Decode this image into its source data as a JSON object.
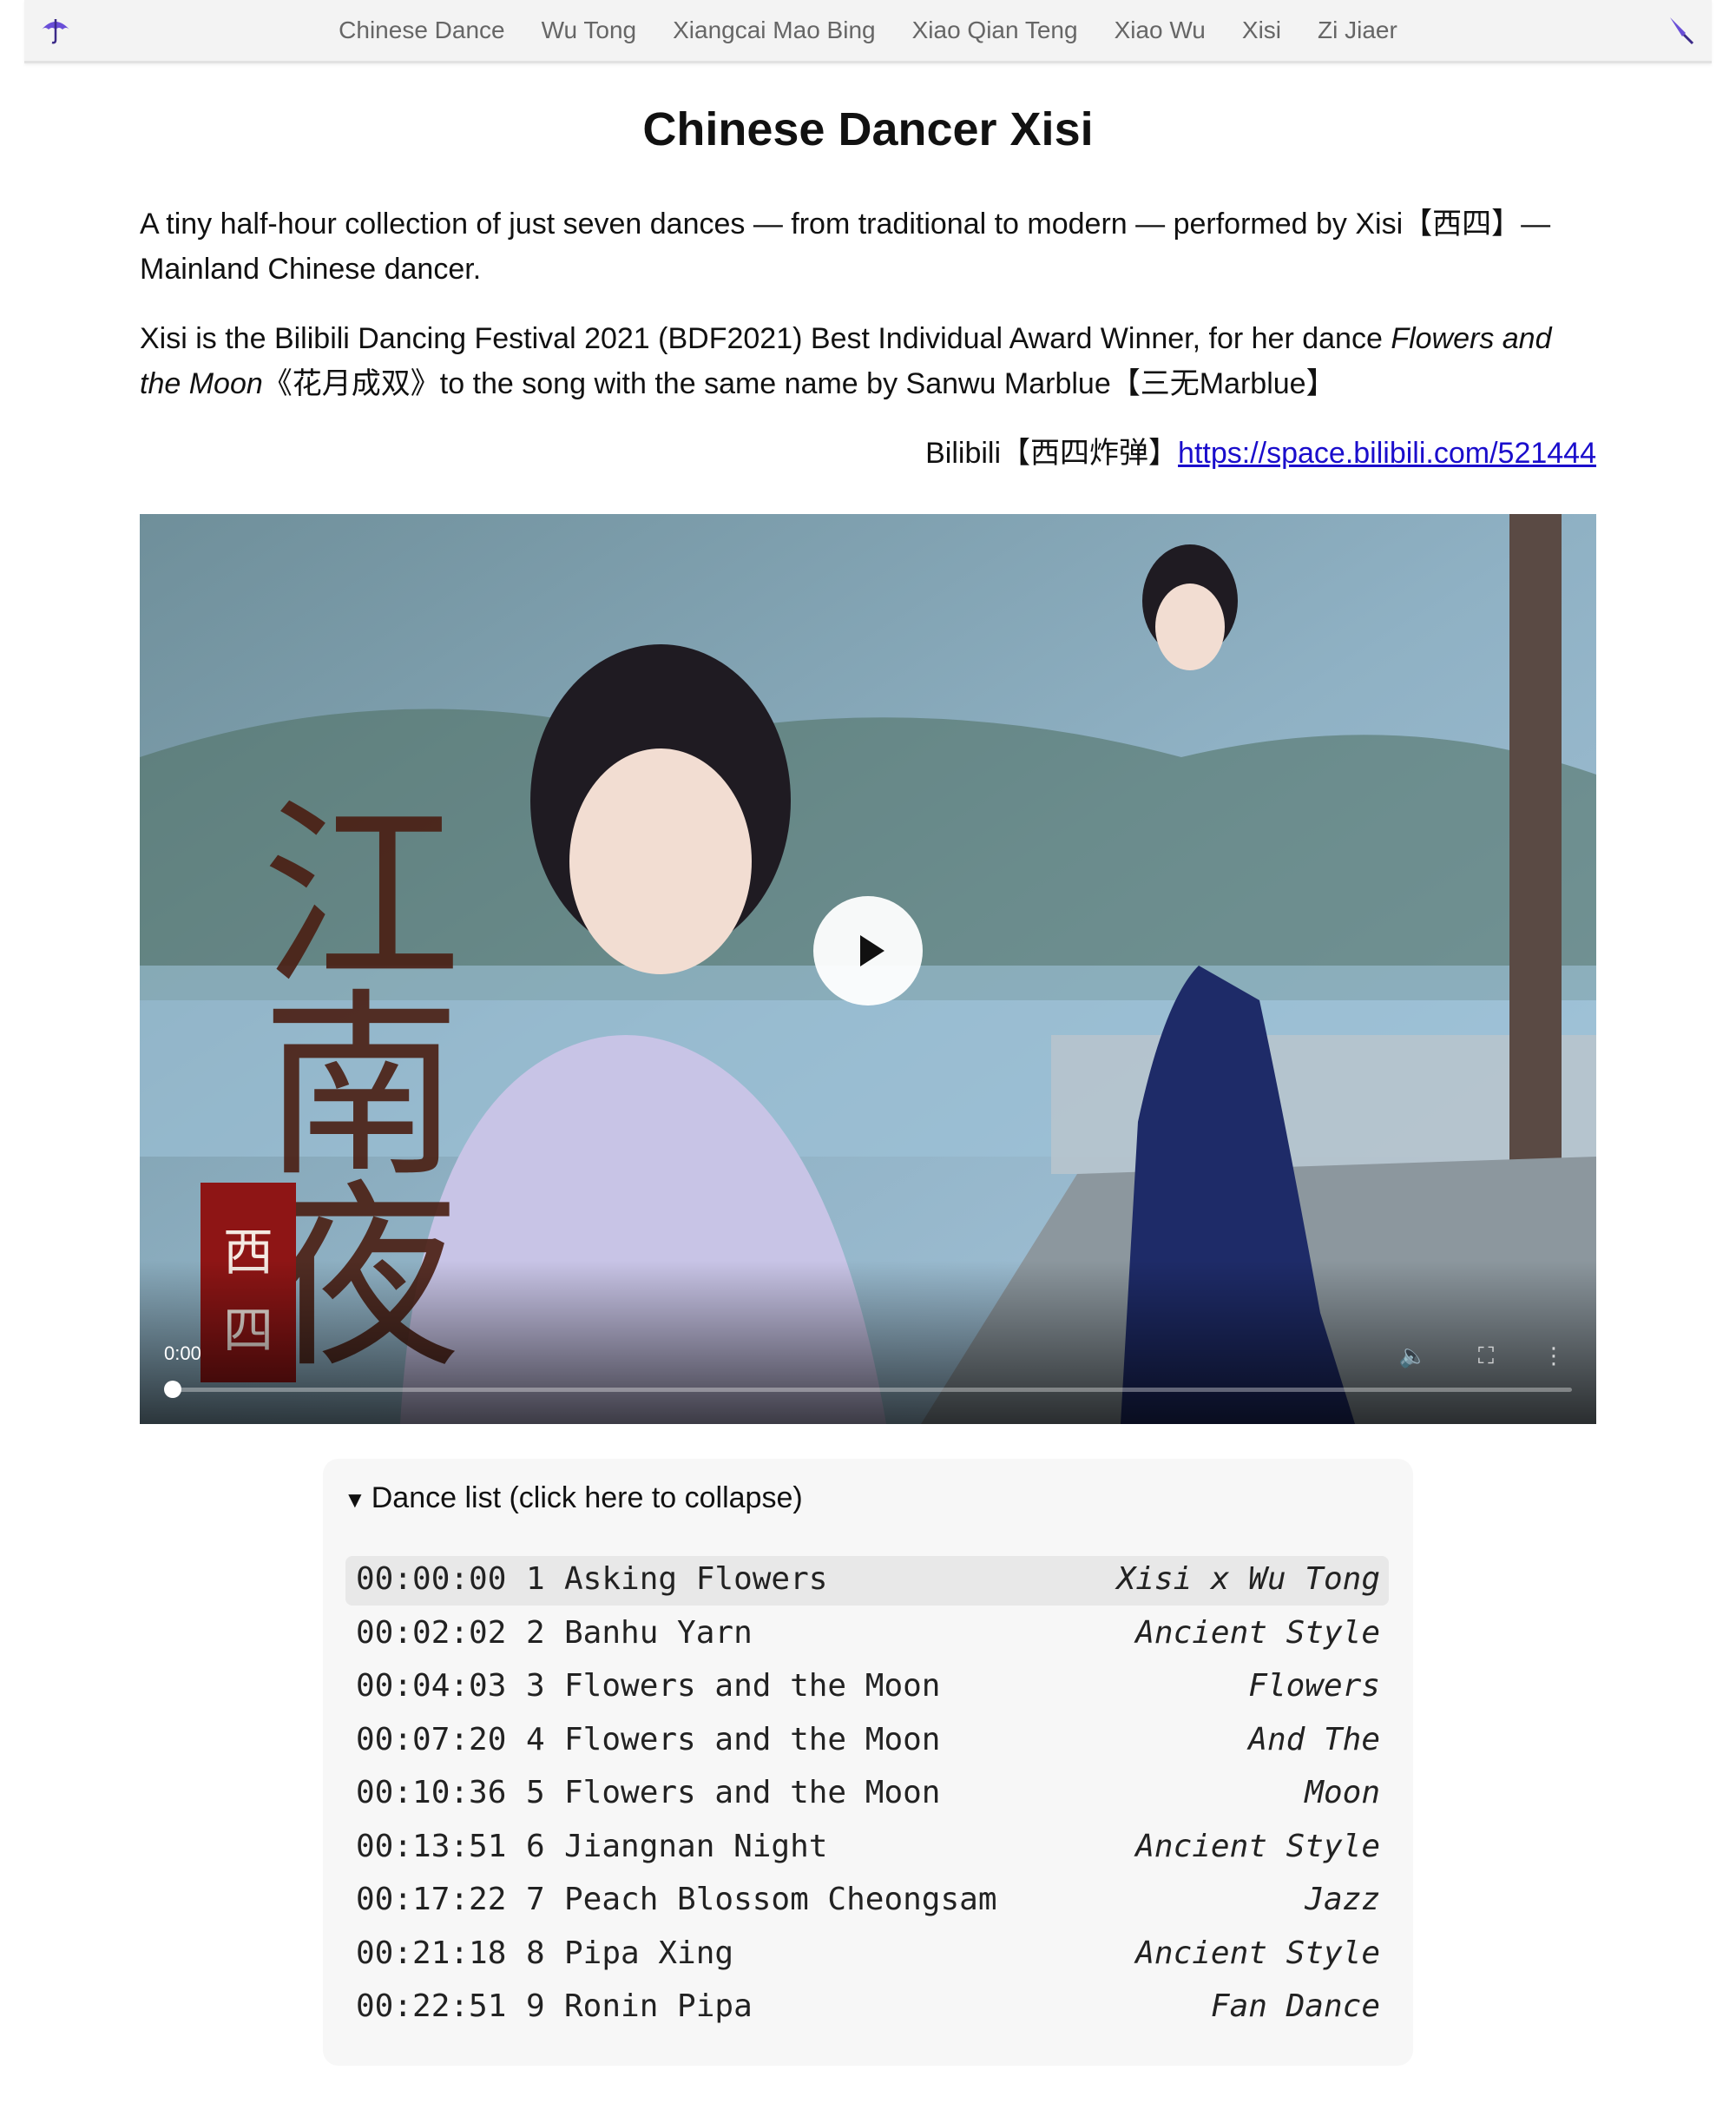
{
  "nav": {
    "left_icon": "umbrella-open-icon",
    "right_icon": "umbrella-closed-icon",
    "links": [
      "Chinese Dance",
      "Wu Tong",
      "Xiangcai Mao Bing",
      "Xiao Qian Teng",
      "Xiao Wu",
      "Xisi",
      "Zi Jiaer"
    ]
  },
  "page": {
    "title": "Chinese Dancer Xisi",
    "intro": "A tiny half-hour collection of just seven dances — from traditional to modern — performed by Xisi【西四】— Mainland Chinese dancer.",
    "award_text_1": "Xisi is the Bilibili Dancing Festival 2021 (BDF2021) Best Individual Award Winner, for her dance ",
    "award_italic": "Flowers and the Moon",
    "award_text_2": "《花月成双》to the song with the same name by Sanwu Marblue【三无Marblue】",
    "bili_label": "Bilibili【西四炸弹】",
    "bili_link": "https://space.bilibili.com/521444"
  },
  "video": {
    "time": "0:00",
    "progress": 0,
    "calligraphy": "江南夜",
    "seal": "西四",
    "controls": [
      "volume-icon",
      "fullscreen-icon",
      "more-icon"
    ]
  },
  "dance_list": {
    "summary": "Dance list (click here to collapse)",
    "rows": [
      {
        "time": "00:00:00",
        "num": "1",
        "title": "Asking Flowers",
        "style": "Xisi x Wu Tong"
      },
      {
        "time": "00:02:02",
        "num": "2",
        "title": "Banhu Yarn",
        "style": "Ancient Style"
      },
      {
        "time": "00:04:03",
        "num": "3",
        "title": "Flowers and the Moon",
        "style": "Flowers"
      },
      {
        "time": "00:07:20",
        "num": "4",
        "title": "Flowers and the Moon",
        "style": "And The"
      },
      {
        "time": "00:10:36",
        "num": "5",
        "title": "Flowers and the Moon",
        "style": "Moon"
      },
      {
        "time": "00:13:51",
        "num": "6",
        "title": "Jiangnan Night",
        "style": "Ancient Style"
      },
      {
        "time": "00:17:22",
        "num": "7",
        "title": "Peach Blossom Cheongsam",
        "style": "Jazz"
      },
      {
        "time": "00:21:18",
        "num": "8",
        "title": "Pipa Xing",
        "style": "Ancient Style"
      },
      {
        "time": "00:22:51",
        "num": "9",
        "title": "Ronin Pipa",
        "style": "Fan Dance"
      }
    ]
  }
}
